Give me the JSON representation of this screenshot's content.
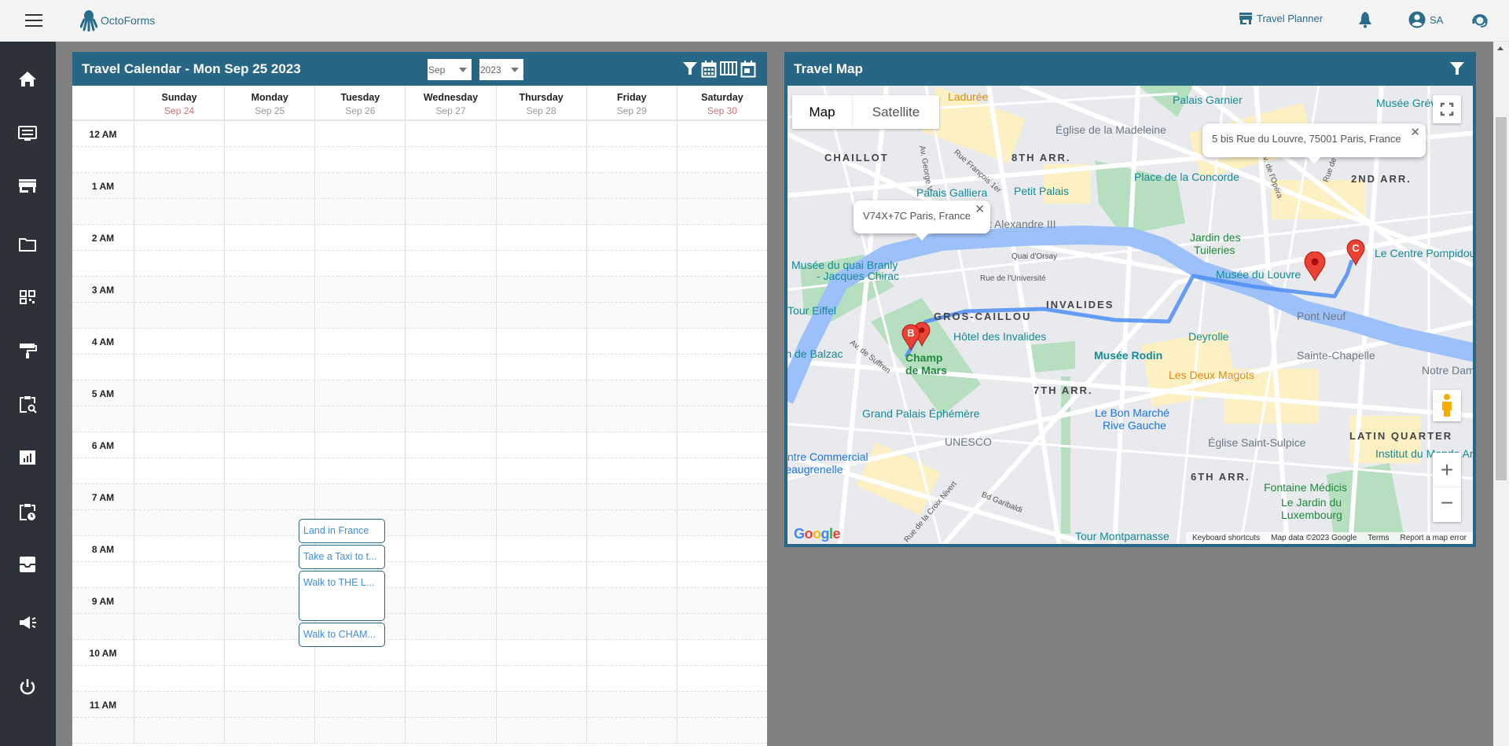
{
  "app": {
    "name": "OctoForms",
    "accent": "#276785"
  },
  "topbar": {
    "planner_label": "Travel Planner",
    "user_initials": "SA"
  },
  "sidebar": {
    "icons": [
      "home-icon",
      "settings-monitor-icon",
      "store-icon",
      "folder-icon",
      "qr-code-icon",
      "paint-roller-icon",
      "clipboard-search-icon",
      "report-chart-icon",
      "clipboard-clock-icon",
      "inbox-icon",
      "megaphone-icon",
      "power-icon"
    ]
  },
  "calendar": {
    "title": "Travel Calendar - Mon Sep 25 2023",
    "month_select": "Sep",
    "year_select": "2023",
    "days": [
      {
        "name": "Sunday",
        "date": "Sep 24",
        "weekend": true
      },
      {
        "name": "Monday",
        "date": "Sep 25"
      },
      {
        "name": "Tuesday",
        "date": "Sep 26"
      },
      {
        "name": "Wednesday",
        "date": "Sep 27"
      },
      {
        "name": "Thursday",
        "date": "Sep 28"
      },
      {
        "name": "Friday",
        "date": "Sep 29"
      },
      {
        "name": "Saturday",
        "date": "Sep 30",
        "weekend": true
      }
    ],
    "hours": [
      "12 AM",
      "1 AM",
      "2 AM",
      "3 AM",
      "4 AM",
      "5 AM",
      "6 AM",
      "7 AM",
      "8 AM",
      "9 AM",
      "10 AM",
      "11 AM"
    ],
    "events": [
      {
        "title": "Land in France",
        "day": "Monday",
        "start": "8:00 AM",
        "end": "8:30 AM"
      },
      {
        "title": "Take a Taxi to t...",
        "day": "Monday",
        "start": "8:30 AM",
        "end": "9:00 AM"
      },
      {
        "title": "Walk to THE L...",
        "day": "Monday",
        "start": "9:00 AM",
        "end": "10:00 AM"
      },
      {
        "title": "Walk to CHAM...",
        "day": "Monday",
        "start": "10:00 AM",
        "end": "10:30 AM"
      }
    ]
  },
  "map": {
    "title": "Travel Map",
    "type_map": "Map",
    "type_satellite": "Satellite",
    "info_a": "V74X+7C Paris, France",
    "info_c": "5 bis Rue du Louvre, 75001 Paris, France",
    "marker_b": "B",
    "marker_c": "C",
    "labels": [
      "Ladurée",
      "Église de la Madeleine",
      "CHAILLOT",
      "8TH ARR.",
      "Palais Galliera",
      "Petit Palais",
      "Pont Alexandre III",
      "Musée du quai Branly",
      "- Jacques Chirac",
      "Quai d'Orsay",
      "Rue de l'Université",
      "INVALIDES",
      "Tour Eiffel",
      "Palais Garnier",
      "Musée Grévin",
      "Place de la Concorde",
      "2ND ARR.",
      "Jardin des",
      "Tuileries",
      "Le Centre Pompidou",
      "Musée du Louvre",
      "Pont Neuf",
      "GROS-CAILLOU",
      "Hôtel des Invalides",
      "Musée Rodin",
      "Maison de Balzac",
      "Champ",
      "de Mars",
      "7TH ARR.",
      "Grand Palais Éphémère",
      "Le Bon Marché",
      "Rive Gauche",
      "UNESCO",
      "Centre Commercial",
      "Beaugrenelle",
      "Bd Garibaldi",
      "Tour Montparnasse",
      "Deyrolle",
      "Les Deux Magots",
      "Sainte-Chapelle",
      "Notre Dame",
      "Église Saint-Sulpice",
      "LATIN QUARTER",
      "Institut du Monde Arabe",
      "6TH ARR.",
      "Fontaine Médicis",
      "Le Jardin du",
      "Luxembourg",
      "Av. George V",
      "Rue François 1er",
      "Av. de l'Opéra",
      "Rue de Richelieu",
      "Av. de Suffren",
      "Rue de la Croix Nivert"
    ],
    "footer": [
      "Keyboard shortcuts",
      "Map data ©2023 Google",
      "Terms",
      "Report a map error"
    ],
    "logo": "Google"
  }
}
